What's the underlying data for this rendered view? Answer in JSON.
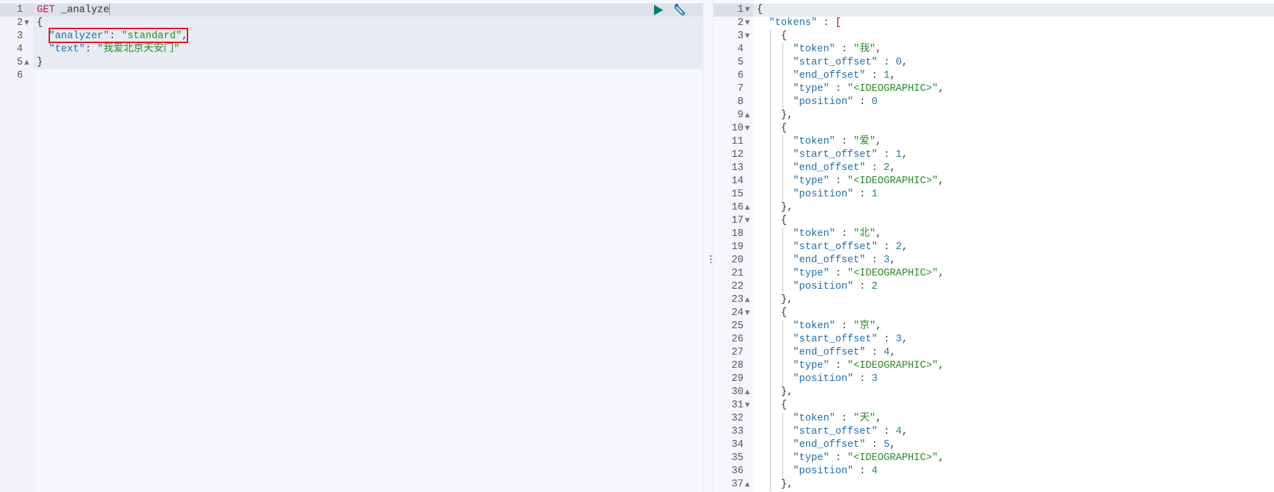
{
  "request_editor": {
    "active_line": 1,
    "highlighted_lines": 5,
    "lines": [
      {
        "n": "1",
        "fold": "",
        "segs": [
          [
            "m",
            "GET"
          ],
          [
            "p",
            " _analyze"
          ]
        ]
      },
      {
        "n": "2",
        "fold": "open",
        "segs": [
          [
            "p",
            "{"
          ]
        ]
      },
      {
        "n": "3",
        "fold": "",
        "segs": [
          [
            "p",
            "  "
          ],
          [
            "k",
            "\"analyzer\""
          ],
          [
            "p",
            ": "
          ],
          [
            "s",
            "\"standard\""
          ],
          [
            "p",
            ","
          ]
        ]
      },
      {
        "n": "4",
        "fold": "",
        "segs": [
          [
            "p",
            "  "
          ],
          [
            "k",
            "\"text\""
          ],
          [
            "p",
            ": "
          ],
          [
            "s",
            "\"我爱北京天安门\""
          ]
        ]
      },
      {
        "n": "5",
        "fold": "close",
        "segs": [
          [
            "p",
            "}"
          ]
        ]
      },
      {
        "n": "6",
        "fold": "",
        "segs": []
      }
    ],
    "play_icon": "play-icon",
    "wrench_icon": "wrench-icon",
    "play_color": "#017d73",
    "wrench_color": "#006bb4",
    "highlight_box_color": "#e8121c"
  },
  "splitter": {
    "grip": "⋮"
  },
  "response_editor": {
    "active_line": 1,
    "lines": [
      {
        "n": "1",
        "fold": "open",
        "segs": [
          [
            "p",
            "{"
          ]
        ]
      },
      {
        "n": "2",
        "fold": "open",
        "segs": [
          [
            "p",
            "  "
          ],
          [
            "k",
            "\"tokens\""
          ],
          [
            "p",
            " : "
          ],
          [
            "b",
            "["
          ]
        ]
      },
      {
        "n": "3",
        "fold": "open",
        "segs": [
          [
            "p",
            "    {"
          ]
        ]
      },
      {
        "n": "4",
        "fold": "",
        "segs": [
          [
            "p",
            "      "
          ],
          [
            "k",
            "\"token\""
          ],
          [
            "p",
            " : "
          ],
          [
            "s",
            "\"我\""
          ],
          [
            "p",
            ","
          ]
        ]
      },
      {
        "n": "5",
        "fold": "",
        "segs": [
          [
            "p",
            "      "
          ],
          [
            "k",
            "\"start_offset\""
          ],
          [
            "p",
            " : "
          ],
          [
            "n",
            "0"
          ],
          [
            "p",
            ","
          ]
        ]
      },
      {
        "n": "6",
        "fold": "",
        "segs": [
          [
            "p",
            "      "
          ],
          [
            "k",
            "\"end_offset\""
          ],
          [
            "p",
            " : "
          ],
          [
            "n",
            "1"
          ],
          [
            "p",
            ","
          ]
        ]
      },
      {
        "n": "7",
        "fold": "",
        "segs": [
          [
            "p",
            "      "
          ],
          [
            "k",
            "\"type\""
          ],
          [
            "p",
            " : "
          ],
          [
            "s",
            "\"<IDEOGRAPHIC>\""
          ],
          [
            "p",
            ","
          ]
        ]
      },
      {
        "n": "8",
        "fold": "",
        "segs": [
          [
            "p",
            "      "
          ],
          [
            "k",
            "\"position\""
          ],
          [
            "p",
            " : "
          ],
          [
            "n",
            "0"
          ]
        ]
      },
      {
        "n": "9",
        "fold": "close",
        "segs": [
          [
            "p",
            "    },"
          ]
        ]
      },
      {
        "n": "10",
        "fold": "open",
        "segs": [
          [
            "p",
            "    {"
          ]
        ]
      },
      {
        "n": "11",
        "fold": "",
        "segs": [
          [
            "p",
            "      "
          ],
          [
            "k",
            "\"token\""
          ],
          [
            "p",
            " : "
          ],
          [
            "s",
            "\"爱\""
          ],
          [
            "p",
            ","
          ]
        ]
      },
      {
        "n": "12",
        "fold": "",
        "segs": [
          [
            "p",
            "      "
          ],
          [
            "k",
            "\"start_offset\""
          ],
          [
            "p",
            " : "
          ],
          [
            "n",
            "1"
          ],
          [
            "p",
            ","
          ]
        ]
      },
      {
        "n": "13",
        "fold": "",
        "segs": [
          [
            "p",
            "      "
          ],
          [
            "k",
            "\"end_offset\""
          ],
          [
            "p",
            " : "
          ],
          [
            "n",
            "2"
          ],
          [
            "p",
            ","
          ]
        ]
      },
      {
        "n": "14",
        "fold": "",
        "segs": [
          [
            "p",
            "      "
          ],
          [
            "k",
            "\"type\""
          ],
          [
            "p",
            " : "
          ],
          [
            "s",
            "\"<IDEOGRAPHIC>\""
          ],
          [
            "p",
            ","
          ]
        ]
      },
      {
        "n": "15",
        "fold": "",
        "segs": [
          [
            "p",
            "      "
          ],
          [
            "k",
            "\"position\""
          ],
          [
            "p",
            " : "
          ],
          [
            "n",
            "1"
          ]
        ]
      },
      {
        "n": "16",
        "fold": "close",
        "segs": [
          [
            "p",
            "    },"
          ]
        ]
      },
      {
        "n": "17",
        "fold": "open",
        "segs": [
          [
            "p",
            "    {"
          ]
        ]
      },
      {
        "n": "18",
        "fold": "",
        "segs": [
          [
            "p",
            "      "
          ],
          [
            "k",
            "\"token\""
          ],
          [
            "p",
            " : "
          ],
          [
            "s",
            "\"北\""
          ],
          [
            "p",
            ","
          ]
        ]
      },
      {
        "n": "19",
        "fold": "",
        "segs": [
          [
            "p",
            "      "
          ],
          [
            "k",
            "\"start_offset\""
          ],
          [
            "p",
            " : "
          ],
          [
            "n",
            "2"
          ],
          [
            "p",
            ","
          ]
        ]
      },
      {
        "n": "20",
        "fold": "",
        "segs": [
          [
            "p",
            "      "
          ],
          [
            "k",
            "\"end_offset\""
          ],
          [
            "p",
            " : "
          ],
          [
            "n",
            "3"
          ],
          [
            "p",
            ","
          ]
        ]
      },
      {
        "n": "21",
        "fold": "",
        "segs": [
          [
            "p",
            "      "
          ],
          [
            "k",
            "\"type\""
          ],
          [
            "p",
            " : "
          ],
          [
            "s",
            "\"<IDEOGRAPHIC>\""
          ],
          [
            "p",
            ","
          ]
        ]
      },
      {
        "n": "22",
        "fold": "",
        "segs": [
          [
            "p",
            "      "
          ],
          [
            "k",
            "\"position\""
          ],
          [
            "p",
            " : "
          ],
          [
            "n",
            "2"
          ]
        ]
      },
      {
        "n": "23",
        "fold": "close",
        "segs": [
          [
            "p",
            "    },"
          ]
        ]
      },
      {
        "n": "24",
        "fold": "open",
        "segs": [
          [
            "p",
            "    {"
          ]
        ]
      },
      {
        "n": "25",
        "fold": "",
        "segs": [
          [
            "p",
            "      "
          ],
          [
            "k",
            "\"token\""
          ],
          [
            "p",
            " : "
          ],
          [
            "s",
            "\"京\""
          ],
          [
            "p",
            ","
          ]
        ]
      },
      {
        "n": "26",
        "fold": "",
        "segs": [
          [
            "p",
            "      "
          ],
          [
            "k",
            "\"start_offset\""
          ],
          [
            "p",
            " : "
          ],
          [
            "n",
            "3"
          ],
          [
            "p",
            ","
          ]
        ]
      },
      {
        "n": "27",
        "fold": "",
        "segs": [
          [
            "p",
            "      "
          ],
          [
            "k",
            "\"end_offset\""
          ],
          [
            "p",
            " : "
          ],
          [
            "n",
            "4"
          ],
          [
            "p",
            ","
          ]
        ]
      },
      {
        "n": "28",
        "fold": "",
        "segs": [
          [
            "p",
            "      "
          ],
          [
            "k",
            "\"type\""
          ],
          [
            "p",
            " : "
          ],
          [
            "s",
            "\"<IDEOGRAPHIC>\""
          ],
          [
            "p",
            ","
          ]
        ]
      },
      {
        "n": "29",
        "fold": "",
        "segs": [
          [
            "p",
            "      "
          ],
          [
            "k",
            "\"position\""
          ],
          [
            "p",
            " : "
          ],
          [
            "n",
            "3"
          ]
        ]
      },
      {
        "n": "30",
        "fold": "close",
        "segs": [
          [
            "p",
            "    },"
          ]
        ]
      },
      {
        "n": "31",
        "fold": "open",
        "segs": [
          [
            "p",
            "    {"
          ]
        ]
      },
      {
        "n": "32",
        "fold": "",
        "segs": [
          [
            "p",
            "      "
          ],
          [
            "k",
            "\"token\""
          ],
          [
            "p",
            " : "
          ],
          [
            "s",
            "\"天\""
          ],
          [
            "p",
            ","
          ]
        ]
      },
      {
        "n": "33",
        "fold": "",
        "segs": [
          [
            "p",
            "      "
          ],
          [
            "k",
            "\"start_offset\""
          ],
          [
            "p",
            " : "
          ],
          [
            "n",
            "4"
          ],
          [
            "p",
            ","
          ]
        ]
      },
      {
        "n": "34",
        "fold": "",
        "segs": [
          [
            "p",
            "      "
          ],
          [
            "k",
            "\"end_offset\""
          ],
          [
            "p",
            " : "
          ],
          [
            "n",
            "5"
          ],
          [
            "p",
            ","
          ]
        ]
      },
      {
        "n": "35",
        "fold": "",
        "segs": [
          [
            "p",
            "      "
          ],
          [
            "k",
            "\"type\""
          ],
          [
            "p",
            " : "
          ],
          [
            "s",
            "\"<IDEOGRAPHIC>\""
          ],
          [
            "p",
            ","
          ]
        ]
      },
      {
        "n": "36",
        "fold": "",
        "segs": [
          [
            "p",
            "      "
          ],
          [
            "k",
            "\"position\""
          ],
          [
            "p",
            " : "
          ],
          [
            "n",
            "4"
          ]
        ]
      },
      {
        "n": "37",
        "fold": "close",
        "segs": [
          [
            "p",
            "    },"
          ]
        ]
      }
    ]
  }
}
